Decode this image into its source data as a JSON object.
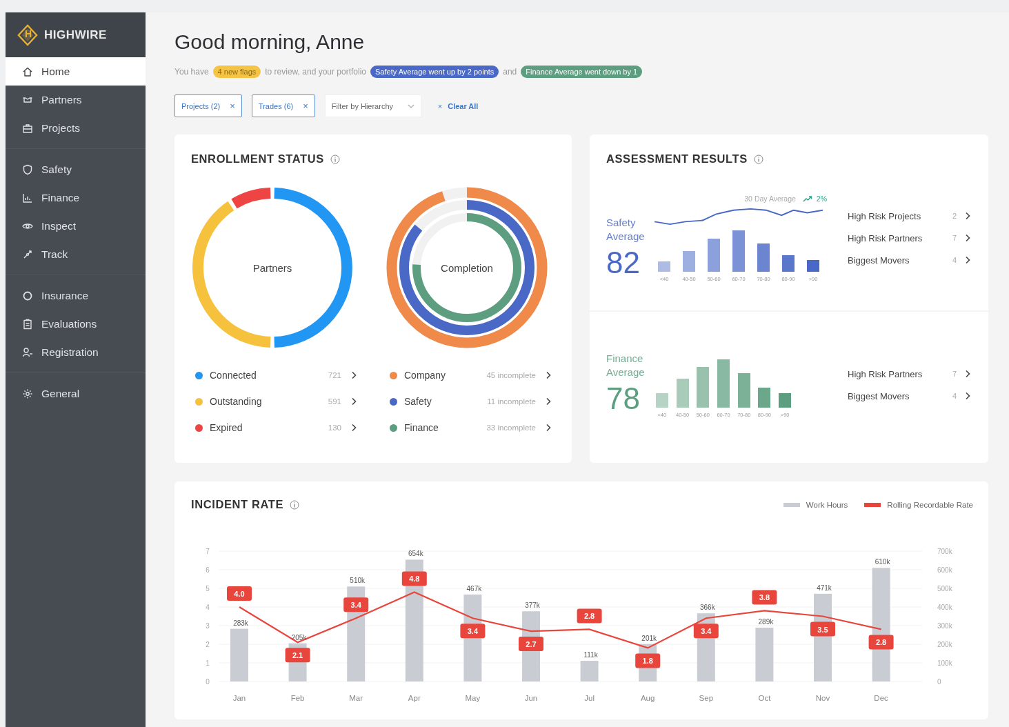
{
  "brand": {
    "name": "HIGHWIRE",
    "monogram": "H"
  },
  "sidebar": {
    "groups": [
      {
        "items": [
          {
            "label": "Home",
            "selected": true
          },
          {
            "label": "Partners",
            "selected": false
          },
          {
            "label": "Projects",
            "selected": false
          }
        ]
      },
      {
        "items": [
          {
            "label": "Safety",
            "selected": false
          },
          {
            "label": "Finance",
            "selected": false
          },
          {
            "label": "Inspect",
            "selected": false
          },
          {
            "label": "Track",
            "selected": false
          }
        ]
      },
      {
        "items": [
          {
            "label": "Insurance",
            "selected": false
          },
          {
            "label": "Evaluations",
            "selected": false
          },
          {
            "label": "Registration",
            "selected": false
          }
        ]
      },
      {
        "items": [
          {
            "label": "General",
            "selected": false
          }
        ]
      }
    ]
  },
  "greeting": "Good morning, Anne",
  "summary": [
    {
      "kind": "text",
      "text": "You have"
    },
    {
      "kind": "pill",
      "text": "4 new flags",
      "color": "#f6c445"
    },
    {
      "kind": "text",
      "text": "to review, and your portfolio"
    },
    {
      "kind": "pill",
      "text": "Safety Average went up by 2 points",
      "color": "#4a69c6"
    },
    {
      "kind": "text",
      "text": "and"
    },
    {
      "kind": "pill",
      "text": "Finance Average went down by 1",
      "color": "#5e9e80"
    }
  ],
  "filters": {
    "chips": [
      {
        "label": "Projects (2)",
        "remove": "×"
      },
      {
        "label": "Trades (6)",
        "remove": "×"
      }
    ],
    "dropdown": {
      "placeholder": "Filter by Hierarchy"
    },
    "clear": {
      "icon": "×",
      "label": "Clear All"
    }
  },
  "enrollment": {
    "title": "ENROLLMENT STATUS",
    "partners": {
      "chart_data": {
        "type": "donut",
        "title": "Partners",
        "categories": [
          "Connected",
          "Outstanding",
          "Expired"
        ],
        "values": [
          50,
          41,
          9
        ]
      },
      "legend": [
        {
          "count": "721",
          "color": "#2196f3"
        },
        {
          "count": "591",
          "color": "#f6c23e"
        },
        {
          "count": "130",
          "color": "#ef4444"
        }
      ]
    },
    "completion": {
      "title": "Completion",
      "rings": [
        {
          "label": "Company",
          "reading": "45 incomplete",
          "color": "#f08a4b",
          "level": 0.95
        },
        {
          "label": "Safety",
          "reading": "11 incomplete",
          "color": "#4a69c6",
          "level": 0.86
        },
        {
          "label": "Finance",
          "reading": "33 incomplete",
          "color": "#5e9e80",
          "level": 0.76
        }
      ]
    }
  },
  "assessment": {
    "title": "ASSESSMENT RESULTS",
    "panels": [
      {
        "kind": "safety",
        "label": "Safety Average",
        "score": "82",
        "color": "#4a69c6",
        "trend": {
          "caption": "30 Day Average",
          "change": "2%"
        },
        "buckets": [
          "<40",
          "40-50",
          "50-60",
          "60-70",
          "70-80",
          "80-90",
          ">90"
        ],
        "links": [
          {
            "label": "High Risk Projects",
            "count": "2"
          },
          {
            "label": "High Risk Partners",
            "count": "7"
          },
          {
            "label": "Biggest Movers",
            "count": "4"
          }
        ]
      },
      {
        "kind": "finance",
        "label": "Finance Average",
        "score": "78",
        "color": "#5e9e80",
        "buckets": [
          "<40",
          "40-50",
          "50-60",
          "60-70",
          "70-80",
          "80-90",
          ">90"
        ],
        "links": [
          {
            "label": "High Risk Partners",
            "count": "7"
          },
          {
            "label": "Biggest Movers",
            "count": "4"
          }
        ]
      }
    ]
  },
  "incident": {
    "title": "INCIDENT RATE",
    "chart_data": {
      "type": "bar",
      "categories": [
        "Jan",
        "Feb",
        "Mar",
        "Apr",
        "May",
        "Jun",
        "Jul",
        "Aug",
        "Sep",
        "Oct",
        "Nov",
        "Dec"
      ],
      "series": [
        {
          "name": "Work Hours",
          "color": "#c9cdd3",
          "axis": "y2",
          "values": [
            283,
            205,
            510,
            654,
            467,
            377,
            111,
            201,
            366,
            289,
            471,
            610
          ],
          "value_labels": [
            "283k",
            "205k",
            "510k",
            "654k",
            "467k",
            "377k",
            "111k",
            "201k",
            "366k",
            "289k",
            "471k",
            "610k"
          ]
        },
        {
          "name": "Rolling Recordable Rate",
          "color": "#e8453c",
          "type": "line",
          "values": [
            4.0,
            2.1,
            3.4,
            4.8,
            3.4,
            2.7,
            2.8,
            1.8,
            3.4,
            3.8,
            3.5,
            2.8
          ],
          "value_labels": [
            "4.0",
            "2.1",
            "3.4",
            "4.8",
            "3.4",
            "2.7",
            "2.8",
            "1.8",
            "3.4",
            "3.8",
            "3.5",
            "2.8"
          ]
        }
      ],
      "grid": true,
      "ylim": [
        0,
        7
      ],
      "yticks": [
        0,
        1,
        2,
        3,
        4,
        5,
        6,
        7
      ],
      "y2lim": [
        0,
        700
      ],
      "y2ticks": [
        {
          "value": 0,
          "label": "0"
        },
        {
          "value": 100,
          "label": "100k"
        },
        {
          "value": 200,
          "label": "200k"
        },
        {
          "value": 300,
          "label": "300k"
        },
        {
          "value": 400,
          "label": "400k"
        },
        {
          "value": 500,
          "label": "500k"
        },
        {
          "value": 600,
          "label": "600k"
        },
        {
          "value": 700,
          "label": "700k"
        }
      ]
    }
  }
}
